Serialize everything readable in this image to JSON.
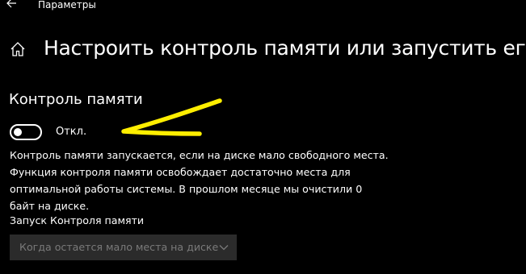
{
  "window": {
    "title": "Параметры",
    "back_icon": "back-arrow-icon"
  },
  "header": {
    "home_icon": "home-icon",
    "title": "Настроить контроль памяти или запустить его"
  },
  "storage_sense": {
    "section_title": "Контроль памяти",
    "toggle": {
      "state_label": "Откл.",
      "is_on": false
    },
    "description_lines": [
      "Контроль памяти запускается, если на диске мало свободного места.",
      "Функция контроля памяти освобождает достаточно места для",
      "оптимальной работы системы. В прошлом месяце мы очистили 0",
      "байт на диске."
    ]
  },
  "run_schedule": {
    "label": "Запуск Контроля памяти",
    "selected_value": "Когда остается мало места на диске",
    "disabled": true,
    "chevron_icon": "chevron-down-icon"
  },
  "annotation": {
    "color": "#ffee00",
    "shape": "hand-drawn-arrow"
  },
  "colors": {
    "background": "#000000",
    "text": "#ffffff",
    "dropdown_bg": "#2b2b2b",
    "disabled_text": "#7a7a7a"
  }
}
